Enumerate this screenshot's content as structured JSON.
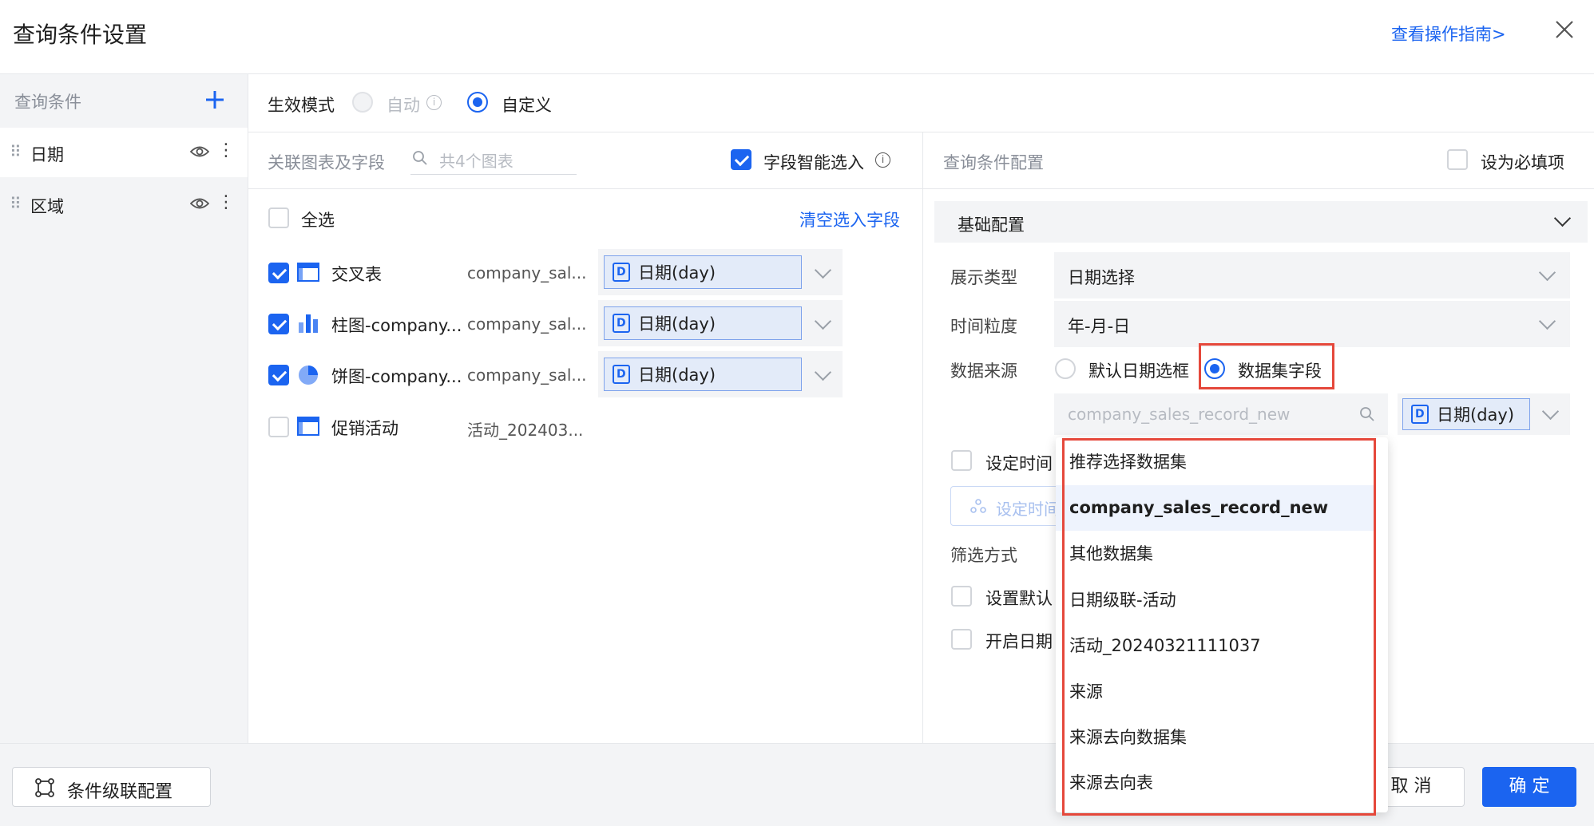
{
  "dialog": {
    "title": "查询条件设置",
    "guide_link": "查看操作指南>"
  },
  "sidebar": {
    "header": "查询条件",
    "items": [
      {
        "label": "日期"
      },
      {
        "label": "区域"
      }
    ]
  },
  "mode": {
    "label": "生效模式",
    "option_auto": "自动",
    "option_custom": "自定义",
    "selected": "自定义"
  },
  "charts_panel": {
    "header": "关联图表及字段",
    "search_placeholder": "共4个图表",
    "smart_select_label": "字段智能选入",
    "smart_select_checked": true,
    "select_all_label": "全选",
    "clear_link": "清空选入字段",
    "rows": [
      {
        "name": "交叉表",
        "dataset": "company_sal...",
        "field": "日期(day)",
        "checked": true,
        "icon": "table-icon"
      },
      {
        "name": "柱图-company...",
        "dataset": "company_sal...",
        "field": "日期(day)",
        "checked": true,
        "icon": "bar-chart-icon"
      },
      {
        "name": "饼图-company...",
        "dataset": "company_sal...",
        "field": "日期(day)",
        "checked": true,
        "icon": "pie-chart-icon"
      },
      {
        "name": "促销活动",
        "dataset": "活动_202403...",
        "field": "",
        "checked": false,
        "icon": "table-icon"
      }
    ]
  },
  "config": {
    "header": "查询条件配置",
    "required_label": "设为必填项",
    "section_title": "基础配置",
    "display_type_label": "展示类型",
    "display_type_value": "日期选择",
    "granularity_label": "时间粒度",
    "granularity_value": "年-月-日",
    "source_label": "数据来源",
    "source_default": "默认日期选框",
    "source_dataset": "数据集字段",
    "dataset_select_value": "company_sales_record_new",
    "dataset_field_value": "日期(day)",
    "set_time_label": "设定时间",
    "set_time_button": "设定时间",
    "filter_label": "筛选方式",
    "set_default_label": "设置默认",
    "enable_date_label": "开启日期"
  },
  "dropdown": {
    "items": [
      {
        "label": "推荐选择数据集",
        "selected": false
      },
      {
        "label": "company_sales_record_new",
        "selected": true
      },
      {
        "label": "其他数据集",
        "selected": false
      },
      {
        "label": "日期级联-活动",
        "selected": false
      },
      {
        "label": "活动_20240321111037",
        "selected": false
      },
      {
        "label": "来源",
        "selected": false
      },
      {
        "label": "来源去向数据集",
        "selected": false
      },
      {
        "label": "来源去向表",
        "selected": false
      }
    ]
  },
  "footer": {
    "cascade_button": "条件级联配置",
    "cancel_button": "取 消",
    "ok_button": "确 定"
  },
  "colors": {
    "accent": "#1b64f0",
    "highlight_box": "#e5483b"
  }
}
